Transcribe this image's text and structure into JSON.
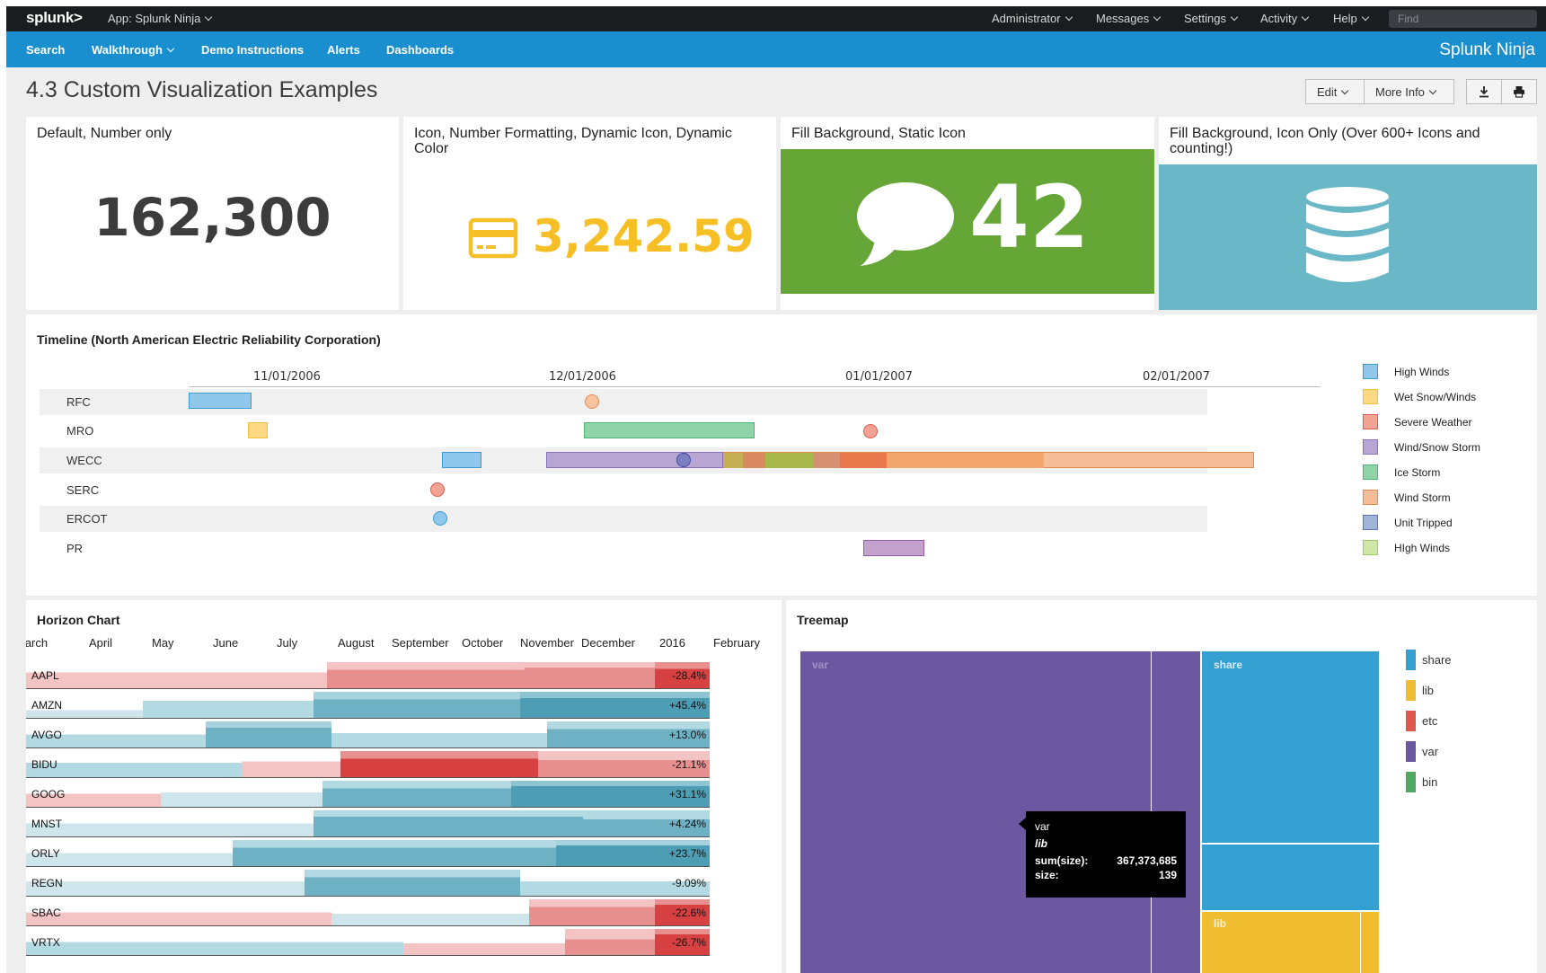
{
  "appbar": {
    "logo": "splunk>",
    "app_label": "App: Splunk Ninja",
    "menus": [
      "Administrator",
      "Messages",
      "Settings",
      "Activity",
      "Help"
    ],
    "find_placeholder": "Find"
  },
  "navbar": {
    "items": [
      "Search",
      "Walkthrough",
      "Demo Instructions",
      "Alerts",
      "Dashboards"
    ],
    "brand": "Splunk Ninja"
  },
  "page": {
    "title": "4.3 Custom Visualization Examples",
    "edit_label": "Edit",
    "more_info_label": "More Info"
  },
  "singles": [
    {
      "title": "Default, Number only",
      "value": "162,300"
    },
    {
      "title": "Icon, Number Formatting, Dynamic Icon, Dynamic Color",
      "value": "3,242.59",
      "color": "#f6bf26",
      "icon": "credit-card-icon"
    },
    {
      "title": "Fill Background, Static Icon",
      "value": "42",
      "color": "#65a637",
      "icon": "comment-icon"
    },
    {
      "title": "Fill Background, Icon Only (Over 600+ Icons and counting!)",
      "color": "#6ab7c7",
      "icon": "database-icon"
    }
  ],
  "timeline": {
    "title": "Timeline (North American Electric Reliability Corporation)",
    "ticks": [
      "11/01/2006",
      "12/01/2006",
      "01/01/2007",
      "02/01/2007"
    ],
    "rows": [
      "RFC",
      "MRO",
      "WECC",
      "SERC",
      "ERCOT",
      "PR"
    ],
    "legend": [
      {
        "label": "High Winds",
        "color": "#6ab7e3"
      },
      {
        "label": "Wet Snow/Winds",
        "color": "#fbd67a"
      },
      {
        "label": "Severe Weather",
        "color": "#ec8a7a"
      },
      {
        "label": "Wind/Snow Storm",
        "color": "#b9a7d6"
      },
      {
        "label": "Ice Storm",
        "color": "#84cfa3"
      },
      {
        "label": "Wind Storm",
        "color": "#f4ac78"
      },
      {
        "label": "Unit Tripped",
        "color": "#7f9dc9"
      },
      {
        "label": "HIgh Winds",
        "color": "#c3e29a"
      }
    ]
  },
  "horizon": {
    "title": "Horizon Chart",
    "months": [
      "March",
      "April",
      "May",
      "June",
      "July",
      "August",
      "September",
      "October",
      "November",
      "December",
      "2016",
      "February"
    ],
    "rows": [
      {
        "name": "AAPL",
        "value": "-28.4%"
      },
      {
        "name": "AMZN",
        "value": "+45.4%"
      },
      {
        "name": "AVGO",
        "value": "+13.0%"
      },
      {
        "name": "BIDU",
        "value": "-21.1%"
      },
      {
        "name": "GOOG",
        "value": "+31.1%"
      },
      {
        "name": "MNST",
        "value": "+4.24%"
      },
      {
        "name": "ORLY",
        "value": "+23.7%"
      },
      {
        "name": "REGN",
        "value": "-9.09%"
      },
      {
        "name": "SBAC",
        "value": "-22.6%"
      },
      {
        "name": "VRTX",
        "value": "-26.7%"
      }
    ]
  },
  "treemap": {
    "title": "Treemap",
    "labels": {
      "var": "var",
      "share": "share",
      "lib": "lib"
    },
    "legend": [
      {
        "label": "share",
        "color": "#34a0d1"
      },
      {
        "label": "lib",
        "color": "#f0bd30"
      },
      {
        "label": "etc",
        "color": "#e0564a"
      },
      {
        "label": "var",
        "color": "#6c57a1"
      },
      {
        "label": "bin",
        "color": "#4da860"
      }
    ],
    "tooltip": {
      "line1": "var",
      "line2": "lib",
      "sum_label": "sum(size):",
      "sum_value": "367,373,685",
      "size_label": "size:",
      "size_value": "139"
    }
  }
}
